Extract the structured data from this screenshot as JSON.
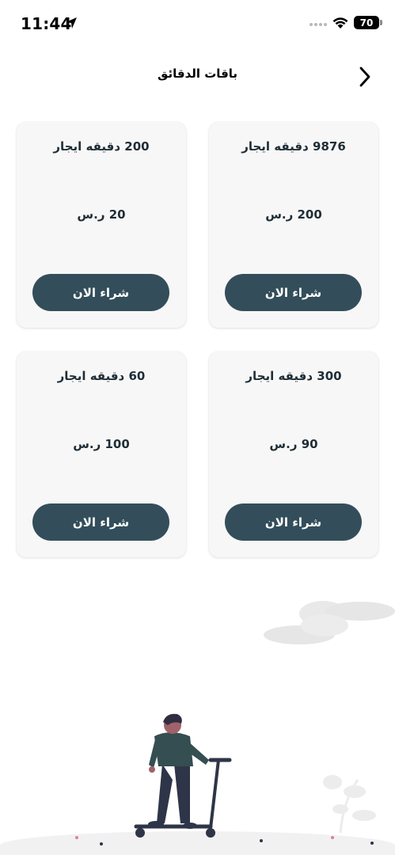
{
  "status_bar": {
    "time": "11:44",
    "battery": "70",
    "icons": [
      "location-arrow-icon",
      "signal-icon",
      "wifi-icon",
      "battery-icon"
    ]
  },
  "header": {
    "title": "باقات الدقائق",
    "back_icon": "chevron-right-icon"
  },
  "packages": [
    {
      "title": "9876 دقيقه ايجار",
      "price": "200 ر.س",
      "button": "شراء الان"
    },
    {
      "title": "200 دقيقه ايجار",
      "price": "20 ر.س",
      "button": "شراء الان"
    },
    {
      "title": "300 دقيقه ايجار",
      "price": "90 ر.س",
      "button": "شراء الان"
    },
    {
      "title": "60 دقيقه ايجار",
      "price": "100 ر.س",
      "button": "شراء الان"
    }
  ],
  "colors": {
    "button": "#334e5a",
    "card_bg": "#f7f7f7",
    "text": "#1f2d36"
  },
  "illustration": "person-riding-scooter-illustration"
}
